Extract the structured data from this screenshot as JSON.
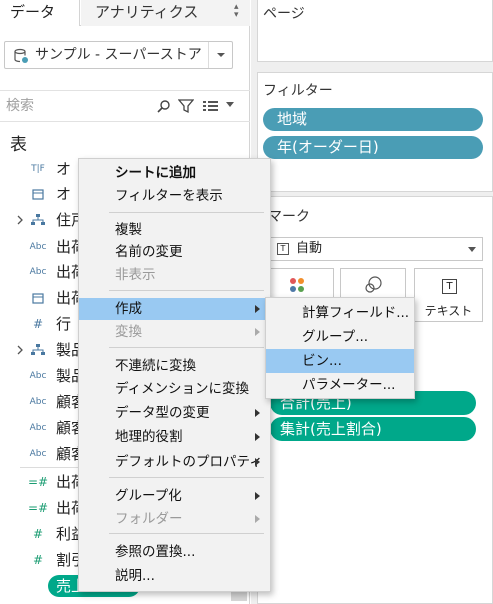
{
  "tabs": {
    "data": "データ",
    "analytics": "アナリティクス"
  },
  "datasource": {
    "label": "サンプル - スーパーストア"
  },
  "search": {
    "placeholder": "検索"
  },
  "section_title": "表",
  "fields": [
    {
      "label": "オ",
      "type": "T|F"
    },
    {
      "label": "オ",
      "type": "date"
    },
    {
      "label": "住戸",
      "type": "hierarchy"
    },
    {
      "label": "出荷",
      "type": "Abc"
    },
    {
      "label": "出荷",
      "type": "Abc"
    },
    {
      "label": "出荷",
      "type": "date"
    },
    {
      "label": "行",
      "type": "#"
    },
    {
      "label": "製品",
      "type": "hierarchy"
    },
    {
      "label": "製品",
      "type": "Abc"
    },
    {
      "label": "顧客",
      "type": "Abc"
    },
    {
      "label": "顧客",
      "type": "Abc"
    },
    {
      "label": "顧客",
      "type": "Abc"
    },
    {
      "label": "出荷",
      "type": "=#"
    },
    {
      "label": "出荷",
      "type": "=#"
    },
    {
      "label": "利益",
      "type": "#"
    },
    {
      "label": "割引",
      "type": "#"
    }
  ],
  "selected_field": "売上",
  "right": {
    "pages_title": "ページ",
    "filters_title": "フィルター",
    "filters": [
      "地域",
      "年(オーダー日)"
    ],
    "marks_title": "マーク",
    "mark_type": "自動",
    "text_button": "テキスト",
    "shelf_pills": [
      "合計(売上)",
      "集計(売上割合)"
    ]
  },
  "context_menu": {
    "items": [
      {
        "label": "シートに追加",
        "bold": true
      },
      {
        "label": "フィルターを表示"
      },
      {
        "label": "複製"
      },
      {
        "label": "名前の変更"
      },
      {
        "label": "非表示",
        "disabled": true
      },
      {
        "label": "作成",
        "submenu": true,
        "active": true
      },
      {
        "label": "変換",
        "submenu": true,
        "disabled": true
      },
      {
        "label": "不連続に変換"
      },
      {
        "label": "ディメンションに変換"
      },
      {
        "label": "データ型の変更",
        "submenu": true
      },
      {
        "label": "地理的役割",
        "submenu": true
      },
      {
        "label": "デフォルトのプロパティ",
        "submenu": true
      },
      {
        "label": "グループ化",
        "submenu": true
      },
      {
        "label": "フォルダー",
        "submenu": true,
        "disabled": true
      },
      {
        "label": "参照の置換..."
      },
      {
        "label": "説明..."
      }
    ]
  },
  "submenu": {
    "items": [
      "計算フィールド...",
      "グループ...",
      "ビン...",
      "パラメーター..."
    ],
    "active_index": 2
  },
  "colors": {
    "filter_pill": "#4a9db5",
    "measure_pill": "#00a88a",
    "menu_highlight": "#99c9f2"
  }
}
